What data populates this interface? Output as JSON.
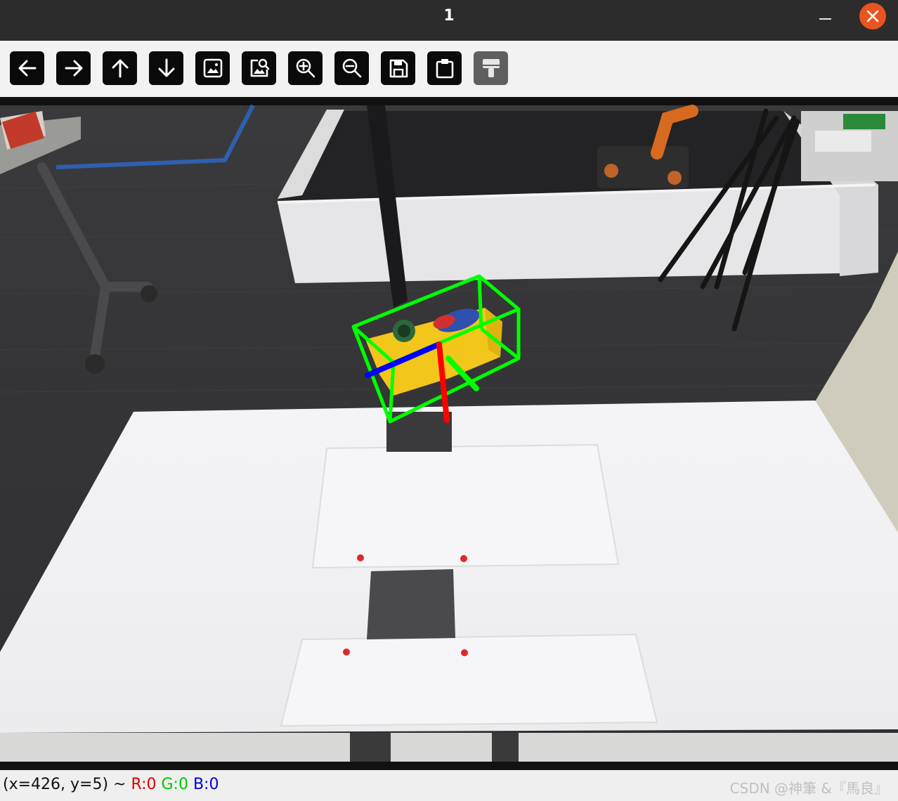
{
  "window": {
    "title": "1",
    "minimize_label": "",
    "close_label": ""
  },
  "toolbar": {
    "buttons": [
      {
        "name": "pan-left",
        "icon": "arrow-left-icon",
        "enabled": true
      },
      {
        "name": "pan-right",
        "icon": "arrow-right-icon",
        "enabled": true
      },
      {
        "name": "pan-up",
        "icon": "arrow-up-icon",
        "enabled": true
      },
      {
        "name": "pan-down",
        "icon": "arrow-down-icon",
        "enabled": true
      },
      {
        "name": "zoom-fit",
        "icon": "image-icon",
        "enabled": true
      },
      {
        "name": "zoom-original",
        "icon": "image-search-icon",
        "enabled": true
      },
      {
        "name": "zoom-in",
        "icon": "zoom-in-icon",
        "enabled": true
      },
      {
        "name": "zoom-out",
        "icon": "zoom-out-icon",
        "enabled": true
      },
      {
        "name": "save",
        "icon": "save-icon",
        "enabled": true
      },
      {
        "name": "copy-to-clipboard",
        "icon": "clipboard-icon",
        "enabled": true
      },
      {
        "name": "properties",
        "icon": "paint-brush-icon",
        "enabled": false
      }
    ]
  },
  "image": {
    "description_icon": "camera-frame",
    "bbox_color": "#00ff00",
    "axis_colors": {
      "x": "#ff0000",
      "y": "#00ff00",
      "z": "#0000ff"
    }
  },
  "status": {
    "coords": "(x=426, y=5) ~ ",
    "r": "R:0",
    "g": "G:0",
    "b": "B:0",
    "watermark": "CSDN @神筆 &『馬良』"
  },
  "colors": {
    "titlebar": "#2c2c2c",
    "close_button": "#e95420",
    "toolbar_button": "#0a0a0a",
    "toolbar_button_disabled": "#5f5f5f"
  }
}
